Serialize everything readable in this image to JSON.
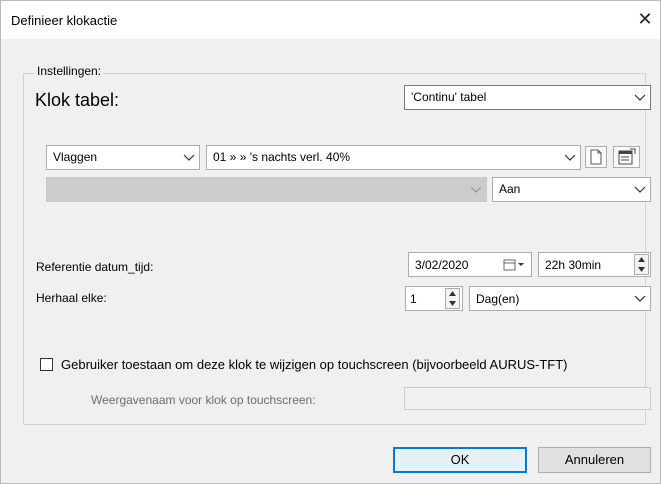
{
  "window": {
    "title": "Definieer klokactie",
    "close_glyph": "✕"
  },
  "group": {
    "label": "Instellingen:"
  },
  "clock_table": {
    "label": "Klok tabel:",
    "selected": "'Continu' tabel"
  },
  "action": {
    "type_selected": "Vlaggen",
    "item_selected": "01  »  » 's nachts verl. 40%",
    "sub_selected": "",
    "state_selected": "Aan"
  },
  "reference": {
    "label": "Referentie datum_tijd:",
    "date": "3/02/2020",
    "time": "22h 30min"
  },
  "repeat": {
    "label": "Herhaal elke:",
    "count": "1",
    "unit": "Dag(en)"
  },
  "touchscreen": {
    "checkbox_label": "Gebruiker toestaan om deze klok te wijzigen op touchscreen (bijvoorbeeld AURUS-TFT)",
    "checked": false,
    "name_label": "Weergavenaam voor klok op touchscreen:",
    "name_value": ""
  },
  "buttons": {
    "ok": "OK",
    "cancel": "Annuleren"
  }
}
